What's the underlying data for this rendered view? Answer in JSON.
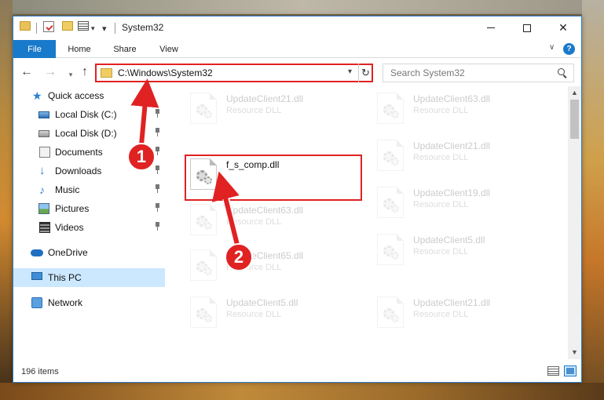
{
  "window": {
    "title": "System32",
    "controls": [
      "minimize",
      "maximize",
      "close"
    ]
  },
  "ribbon": {
    "tabs": [
      "File",
      "Home",
      "Share",
      "View"
    ],
    "help": "?"
  },
  "navbar": {
    "back": "←",
    "forward": "→",
    "recent": "▾",
    "up": "↑",
    "address": "C:\\Windows\\System32",
    "address_dropdown": "▾",
    "refresh": "↻",
    "search_placeholder": "Search System32"
  },
  "sidebar": {
    "items": [
      {
        "label": "Quick access",
        "icon": "star-icon"
      },
      {
        "label": "Local Disk (C:)",
        "icon": "disk-icon",
        "pinned": true
      },
      {
        "label": "Local Disk (D:)",
        "icon": "disk-icon",
        "pinned": true
      },
      {
        "label": "Documents",
        "icon": "documents-icon",
        "pinned": true
      },
      {
        "label": "Downloads",
        "icon": "downloads-icon",
        "pinned": true
      },
      {
        "label": "Music",
        "icon": "music-icon",
        "pinned": true
      },
      {
        "label": "Pictures",
        "icon": "pictures-icon",
        "pinned": true
      },
      {
        "label": "Videos",
        "icon": "videos-icon",
        "pinned": true
      },
      {
        "label": "OneDrive",
        "icon": "onedrive-icon"
      },
      {
        "label": "This PC",
        "icon": "this-pc-icon",
        "selected": true
      },
      {
        "label": "Network",
        "icon": "network-icon"
      }
    ]
  },
  "files": [
    {
      "name": "UpdateClient21.dll",
      "type": "Resource DLL",
      "faded": true
    },
    {
      "name": "UpdateClient63.dll",
      "type": "Resource DLL",
      "faded": true
    },
    {
      "name": "f_s_comp.dll",
      "type": "",
      "faded": false,
      "highlighted": true
    },
    {
      "name": "UpdateClient21.dll",
      "type": "Resource DLL",
      "faded": true
    },
    {
      "name": "UpdateClient63.dll",
      "type": "Resource DLL",
      "faded": true
    },
    {
      "name": "UpdateClient19.dll",
      "type": "Resource DLL",
      "faded": true
    },
    {
      "name": "UpdateClient65.dll",
      "type": "Resource DLL",
      "faded": true
    },
    {
      "name": "UpdateClient5.dll",
      "type": "Resource DLL",
      "faded": true
    },
    {
      "name": "UpdateClient5.dll",
      "type": "Resource DLL",
      "faded": true
    },
    {
      "name": "UpdateClient21.dll",
      "type": "Resource DLL",
      "faded": true
    }
  ],
  "status": {
    "item_count": "196 items"
  },
  "annotations": {
    "step1": "1",
    "step2": "2",
    "color": "#e02222"
  },
  "colors": {
    "accent": "#1979ca",
    "selection": "#cce8ff",
    "highlight": "#e02222"
  }
}
